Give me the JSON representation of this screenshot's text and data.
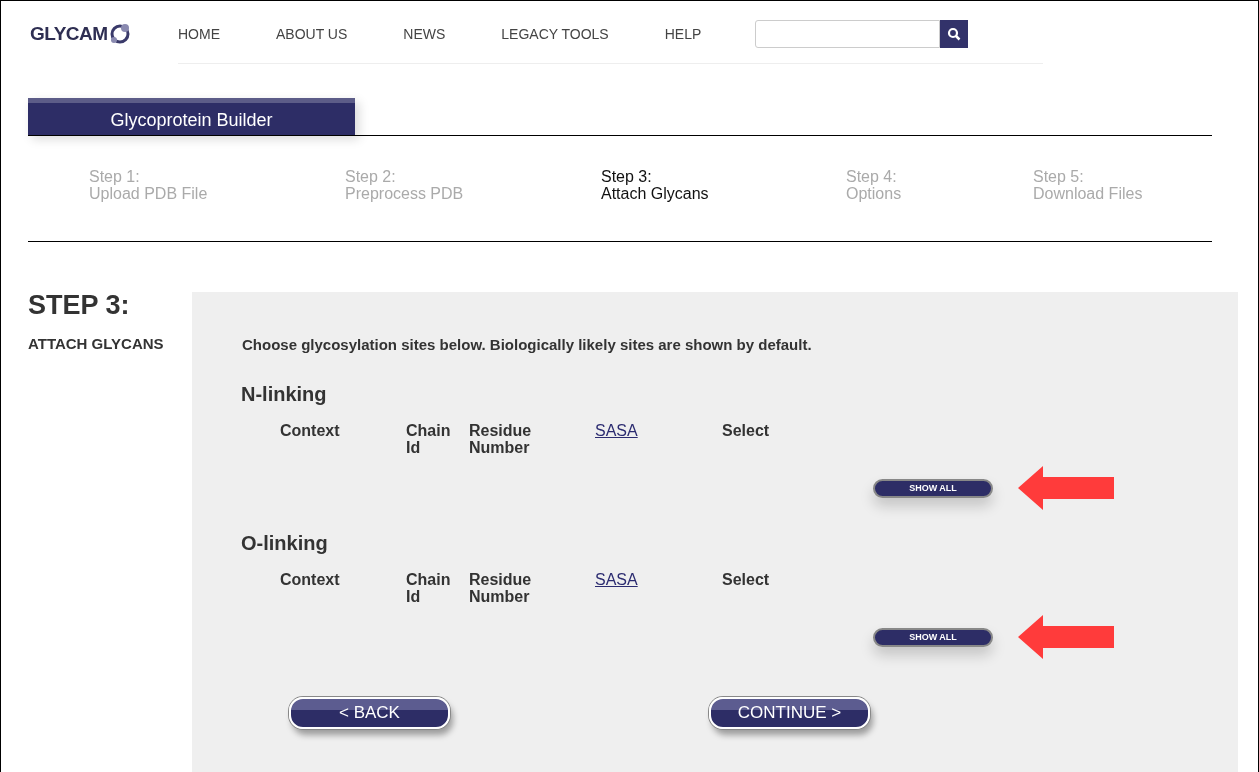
{
  "logo": {
    "text": "GLYCAM"
  },
  "nav": [
    {
      "label": "HOME"
    },
    {
      "label": "ABOUT US"
    },
    {
      "label": "NEWS"
    },
    {
      "label": "LEGACY TOOLS"
    },
    {
      "label": "HELP"
    }
  ],
  "builder_tab": {
    "label": "Glycoprotein Builder"
  },
  "steps": [
    {
      "step": "Step 1:",
      "name": "Upload PDB File",
      "selected": false
    },
    {
      "step": "Step 2:",
      "name": "Preprocess PDB",
      "selected": false
    },
    {
      "step": "Step 3:",
      "name": "Attach Glycans",
      "selected": true
    },
    {
      "step": "Step 4:",
      "name": "Options",
      "selected": false
    },
    {
      "step": "Step 5:",
      "name": "Download Files",
      "selected": false
    }
  ],
  "heading": "STEP 3:",
  "subheading": "ATTACH GLYCANS",
  "intro": "Choose glycosylation sites below. Biologically likely sites are shown by default.",
  "sections": [
    {
      "title": "N-linking",
      "columns": [
        {
          "label": "Context",
          "kind": "text"
        },
        {
          "label": "Chain Id",
          "kind": "text"
        },
        {
          "label": "Residue Number",
          "kind": "text"
        },
        {
          "label": "SASA",
          "kind": "link"
        },
        {
          "label": "Select",
          "kind": "text"
        }
      ],
      "button": "SHOW ALL",
      "arrow": true
    },
    {
      "title": "O-linking",
      "columns": [
        {
          "label": "Context",
          "kind": "text"
        },
        {
          "label": "Chain Id",
          "kind": "text"
        },
        {
          "label": "Residue Number",
          "kind": "text"
        },
        {
          "label": "SASA",
          "kind": "link"
        },
        {
          "label": "Select",
          "kind": "text"
        }
      ],
      "button": "SHOW ALL",
      "arrow": true
    }
  ],
  "buttons": [
    {
      "label": "< BACK"
    },
    {
      "label": "CONTINUE >"
    }
  ]
}
